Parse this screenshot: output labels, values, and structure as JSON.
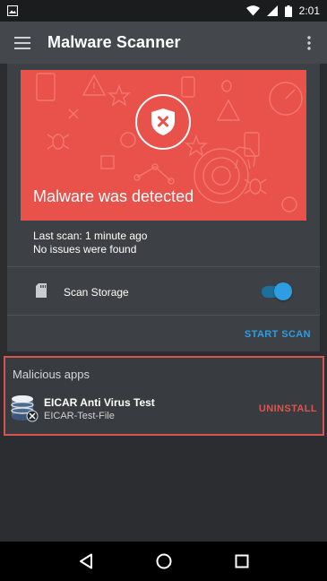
{
  "status_bar": {
    "time": "2:01",
    "icons": [
      "image-icon",
      "wifi-icon",
      "signal-icon",
      "battery-icon"
    ]
  },
  "toolbar": {
    "title": "Malware Scanner",
    "menu_icon": "hamburger-menu-icon",
    "overflow_icon": "more-vert-icon"
  },
  "status_card": {
    "hero": {
      "message": "Malware was detected",
      "icon": "shield-x-icon",
      "background_color": "#e9514b"
    },
    "last_scan": "Last scan: 1 minute ago",
    "issues": "No issues were found",
    "scan_storage": {
      "label": "Scan Storage",
      "icon": "sd-card-icon",
      "enabled": true
    },
    "start_scan_label": "START SCAN"
  },
  "malicious_apps": {
    "heading": "Malicious apps",
    "items": [
      {
        "name": "EICAR Anti Virus Test",
        "package": "EICAR-Test-File",
        "icon": "database-icon",
        "action_label": "UNINSTALL"
      }
    ]
  },
  "navigation": {
    "buttons": [
      "back-icon",
      "home-icon",
      "recents-icon"
    ]
  },
  "colors": {
    "accent": "#2d9ee3",
    "danger": "#e0534d",
    "background": "#2b2d30",
    "toolbar": "#44484d"
  }
}
